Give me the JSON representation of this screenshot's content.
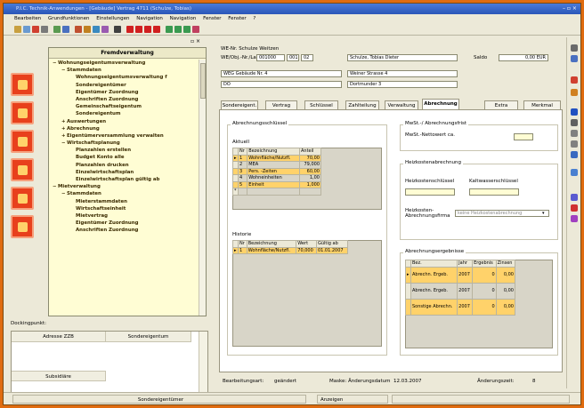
{
  "colors": {
    "accent": "#e06c10",
    "highlight": "#ffd26a",
    "tree_bg": "#fffdd4",
    "nav_btn": "#e8401c"
  },
  "window": {
    "title": "P.I.C. Technik-Anwendungen - [Gebäude] Vertrag 4711 (Schulze, Tobias)"
  },
  "menu": [
    "Bearbeiten",
    "Grundfunktionen",
    "Einstellungen",
    "Navigation",
    "Navigation",
    "Fenster",
    "Fenster",
    "?"
  ],
  "tree": {
    "title": "Fremdverwaltung",
    "items": [
      {
        "label": "Wohnungseigentumsverwaltung",
        "indent": 0,
        "sign": "−"
      },
      {
        "label": "Stammdaten",
        "indent": 1,
        "sign": "−"
      },
      {
        "label": "Wohnungseigentumsverwaltung f",
        "indent": 2,
        "sign": ""
      },
      {
        "label": "Sondereigentümer",
        "indent": 2,
        "sign": ""
      },
      {
        "label": "Eigentümer Zuordnung",
        "indent": 2,
        "sign": ""
      },
      {
        "label": "Anschriften Zuordnung",
        "indent": 2,
        "sign": ""
      },
      {
        "label": "Gemeinschaftseigentum",
        "indent": 2,
        "sign": ""
      },
      {
        "label": "Sondereigentum",
        "indent": 2,
        "sign": ""
      },
      {
        "label": "Auswertungen",
        "indent": 1,
        "sign": "+"
      },
      {
        "label": "Abrechnung",
        "indent": 1,
        "sign": "+"
      },
      {
        "label": "Eigentümerversammlung verwalten",
        "indent": 1,
        "sign": "+"
      },
      {
        "label": "Wirtschaftsplanung",
        "indent": 1,
        "sign": "−"
      },
      {
        "label": "Planzahlen erstellen",
        "indent": 2,
        "sign": ""
      },
      {
        "label": "Budget Konto alle",
        "indent": 2,
        "sign": ""
      },
      {
        "label": "Planzahlen drucken",
        "indent": 2,
        "sign": ""
      },
      {
        "label": "Einzelwirtschaftsplan",
        "indent": 2,
        "sign": ""
      },
      {
        "label": "Einzelwirtschaftsplan gültig ab",
        "indent": 2,
        "sign": ""
      },
      {
        "label": "Mietverwaltung",
        "indent": 0,
        "sign": "−"
      },
      {
        "label": "Stammdaten",
        "indent": 1,
        "sign": "−"
      },
      {
        "label": "Mieterstammdaten",
        "indent": 2,
        "sign": ""
      },
      {
        "label": "Wirtschaftseinheit",
        "indent": 2,
        "sign": ""
      },
      {
        "label": "Mietvertrag",
        "indent": 2,
        "sign": ""
      },
      {
        "label": "Eigentümer Zuordnung",
        "indent": 2,
        "sign": ""
      },
      {
        "label": "Anschriften Zuordnung",
        "indent": 2,
        "sign": ""
      }
    ]
  },
  "dock": {
    "title": "Dockingpunkt:",
    "col1": "Adresse ZZB",
    "col2": "Sondereigentum",
    "col3": "Subsidiäre"
  },
  "header": {
    "we_label": "WE-Nr. Schulze Weitzen",
    "field1_label": "WE/Obj.-Nr./Lage",
    "f_a": "001000",
    "f_b": "001",
    "f_c": "02",
    "name": "Schulze, Tobias Dieter",
    "saldo_label": "Saldo",
    "saldo": "0,00 EUR",
    "addr_label": "WEG Gebäude Nr. 4",
    "street": "Weiner Strasse 4",
    "post": "DO",
    "city": "Dortmunder 3"
  },
  "tabs": [
    "Sondereigent.",
    "Vertrag",
    "Schlüssel",
    "Zahlteilung",
    "Verwaltung",
    "Abrechnung",
    "Extra",
    "Merkmal"
  ],
  "active_tab": 5,
  "abrechnung": {
    "group_title": "Abrechnungsschlüssel",
    "aktuell_label": "Aktuell",
    "cols": [
      "Nr",
      "Bezeichnung",
      "Anteil"
    ],
    "rows": [
      {
        "nr": "1",
        "bez": "Wohnfläche/Nutzfl.",
        "wert": "70,00"
      },
      {
        "nr": "2",
        "bez": "MEA",
        "wert": "79,000"
      },
      {
        "nr": "3",
        "bez": "Pers. -Zeiten",
        "wert": "60,00"
      },
      {
        "nr": "4",
        "bez": "Wohneinheiten",
        "wert": "1,00"
      },
      {
        "nr": "5",
        "bez": "Einheit",
        "wert": "1,000"
      }
    ],
    "historie_label": "Historie",
    "hist_cols": [
      "Nr",
      "Bezeichnung",
      "Wert",
      "Gültig ab"
    ],
    "hist_rows": [
      {
        "nr": "1",
        "bez": "Wohnfläche/Nutzfl.",
        "wert": "70,000",
        "ab": "01.01.2007"
      }
    ]
  },
  "right": {
    "mwst_title": "MwSt.-/ Abrechnungsfrist",
    "mwst_label": "MwSt.-Nettowert ca.",
    "heiz_title": "Heizkostenabrechnung",
    "heiz_lbl1": "Heizkostenschlüssel",
    "heiz_lbl2": "Kaltwasserschlüssel",
    "heiz_lbl3": "Heizkosten-Abrechnungsfirma",
    "heiz_select": "keine Heizkostenabrechnung",
    "ergebnis_title": "Abrechnungsergebnisse",
    "cols": [
      "Bez.",
      "Jahr",
      "Ergebnis",
      "Zinsen"
    ],
    "rows": [
      {
        "bez": "Abrechn. Ergeb.",
        "jahr": "2007",
        "erg": "0",
        "zins": "0,00"
      },
      {
        "bez": "Abrechn. Ergeb.",
        "jahr": "2007",
        "erg": "0",
        "zins": "0,00"
      },
      {
        "bez": "Sonstige Abrechn.",
        "jahr": "2007",
        "erg": "0",
        "zins": "0,00"
      }
    ]
  },
  "footer": {
    "bearb_label": "Bearbeitungsart:",
    "bearb_val": "geändert",
    "maske_label": "Maske: Änderungsdatum",
    "datum": "12.03.2007",
    "zeit_label": "Änderungszeit:",
    "zeit": "8"
  },
  "status": {
    "left": "Sondereigentümer",
    "mid": "Anzeigen"
  }
}
